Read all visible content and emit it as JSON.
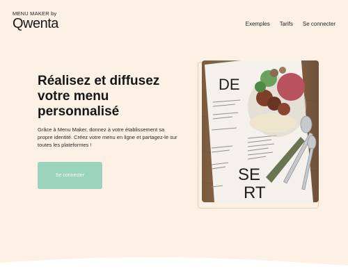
{
  "brand": {
    "tagline": "MENU MAKER by",
    "logo": "Qwenta"
  },
  "nav": {
    "items": [
      "Exemples",
      "Tarifs",
      "Se connecter"
    ]
  },
  "hero": {
    "title": "Réalisez et diffusez votre menu personnalisé",
    "description": "Grâce à Menu Maker, donnez à votre établissement sa propre identité. Créez votre menu en ligne et partagez-le sur toutes les plateformes !",
    "cta_label": "Se connecter"
  },
  "photo": {
    "menu_letters_top": "DE",
    "menu_letters_bottom_1": "SE",
    "menu_letters_bottom_2": "RT"
  },
  "colors": {
    "background": "#fdf0e4",
    "cta": "#9ad3be",
    "wood": "#8a6a4c"
  }
}
